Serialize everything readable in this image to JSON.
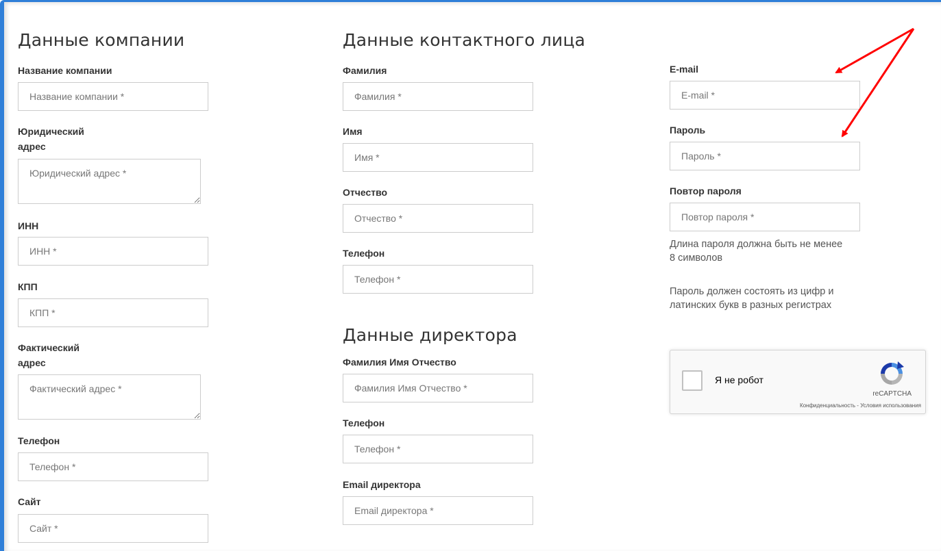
{
  "company": {
    "title": "Данные компании",
    "fields": [
      {
        "label": "Название компании",
        "placeholder": "Название компании *"
      },
      {
        "label": "Юридический адрес",
        "placeholder": "Юридический адрес *"
      },
      {
        "label": "ИНН",
        "placeholder": "ИНН *"
      },
      {
        "label": "КПП",
        "placeholder": "КПП *"
      },
      {
        "label": "Фактический адрес",
        "placeholder": "Фактический адрес *"
      },
      {
        "label": "Телефон",
        "placeholder": "Телефон *"
      },
      {
        "label": "Сайт",
        "placeholder": "Сайт *"
      }
    ]
  },
  "contact": {
    "title": "Данные контактного лица",
    "fields": [
      {
        "label": "Фамилия",
        "placeholder": "Фамилия *"
      },
      {
        "label": "Имя",
        "placeholder": "Имя *"
      },
      {
        "label": "Отчество",
        "placeholder": "Отчество *"
      },
      {
        "label": "Телефон",
        "placeholder": "Телефон *"
      }
    ]
  },
  "director": {
    "title": "Данные директора",
    "fields": [
      {
        "label": "Фамилия Имя Отчество",
        "placeholder": "Фамилия Имя Отчество *"
      },
      {
        "label": "Телефон",
        "placeholder": "Телефон *"
      },
      {
        "label": "Email директора",
        "placeholder": "Email директора *"
      }
    ]
  },
  "account": {
    "fields": [
      {
        "label": "E-mail",
        "placeholder": "E-mail *"
      },
      {
        "label": "Пароль",
        "placeholder": "Пароль *"
      },
      {
        "label": "Повтор пароля",
        "placeholder": "Повтор пароля *"
      }
    ],
    "hint_length": "Длина пароля должна быть не менее 8 символов",
    "hint_chars": "Пароль должен состоять из цифр и латинских букв в разных регистрах"
  },
  "captcha": {
    "label": "Я не робот",
    "brand": "reCAPTCHA",
    "links": "Конфиденциальность - Условия использования",
    "logo_icon": "recaptcha-logo-icon"
  },
  "colors": {
    "frame_border": "#2f7fd8",
    "annotation_arrow": "#ff0000"
  }
}
